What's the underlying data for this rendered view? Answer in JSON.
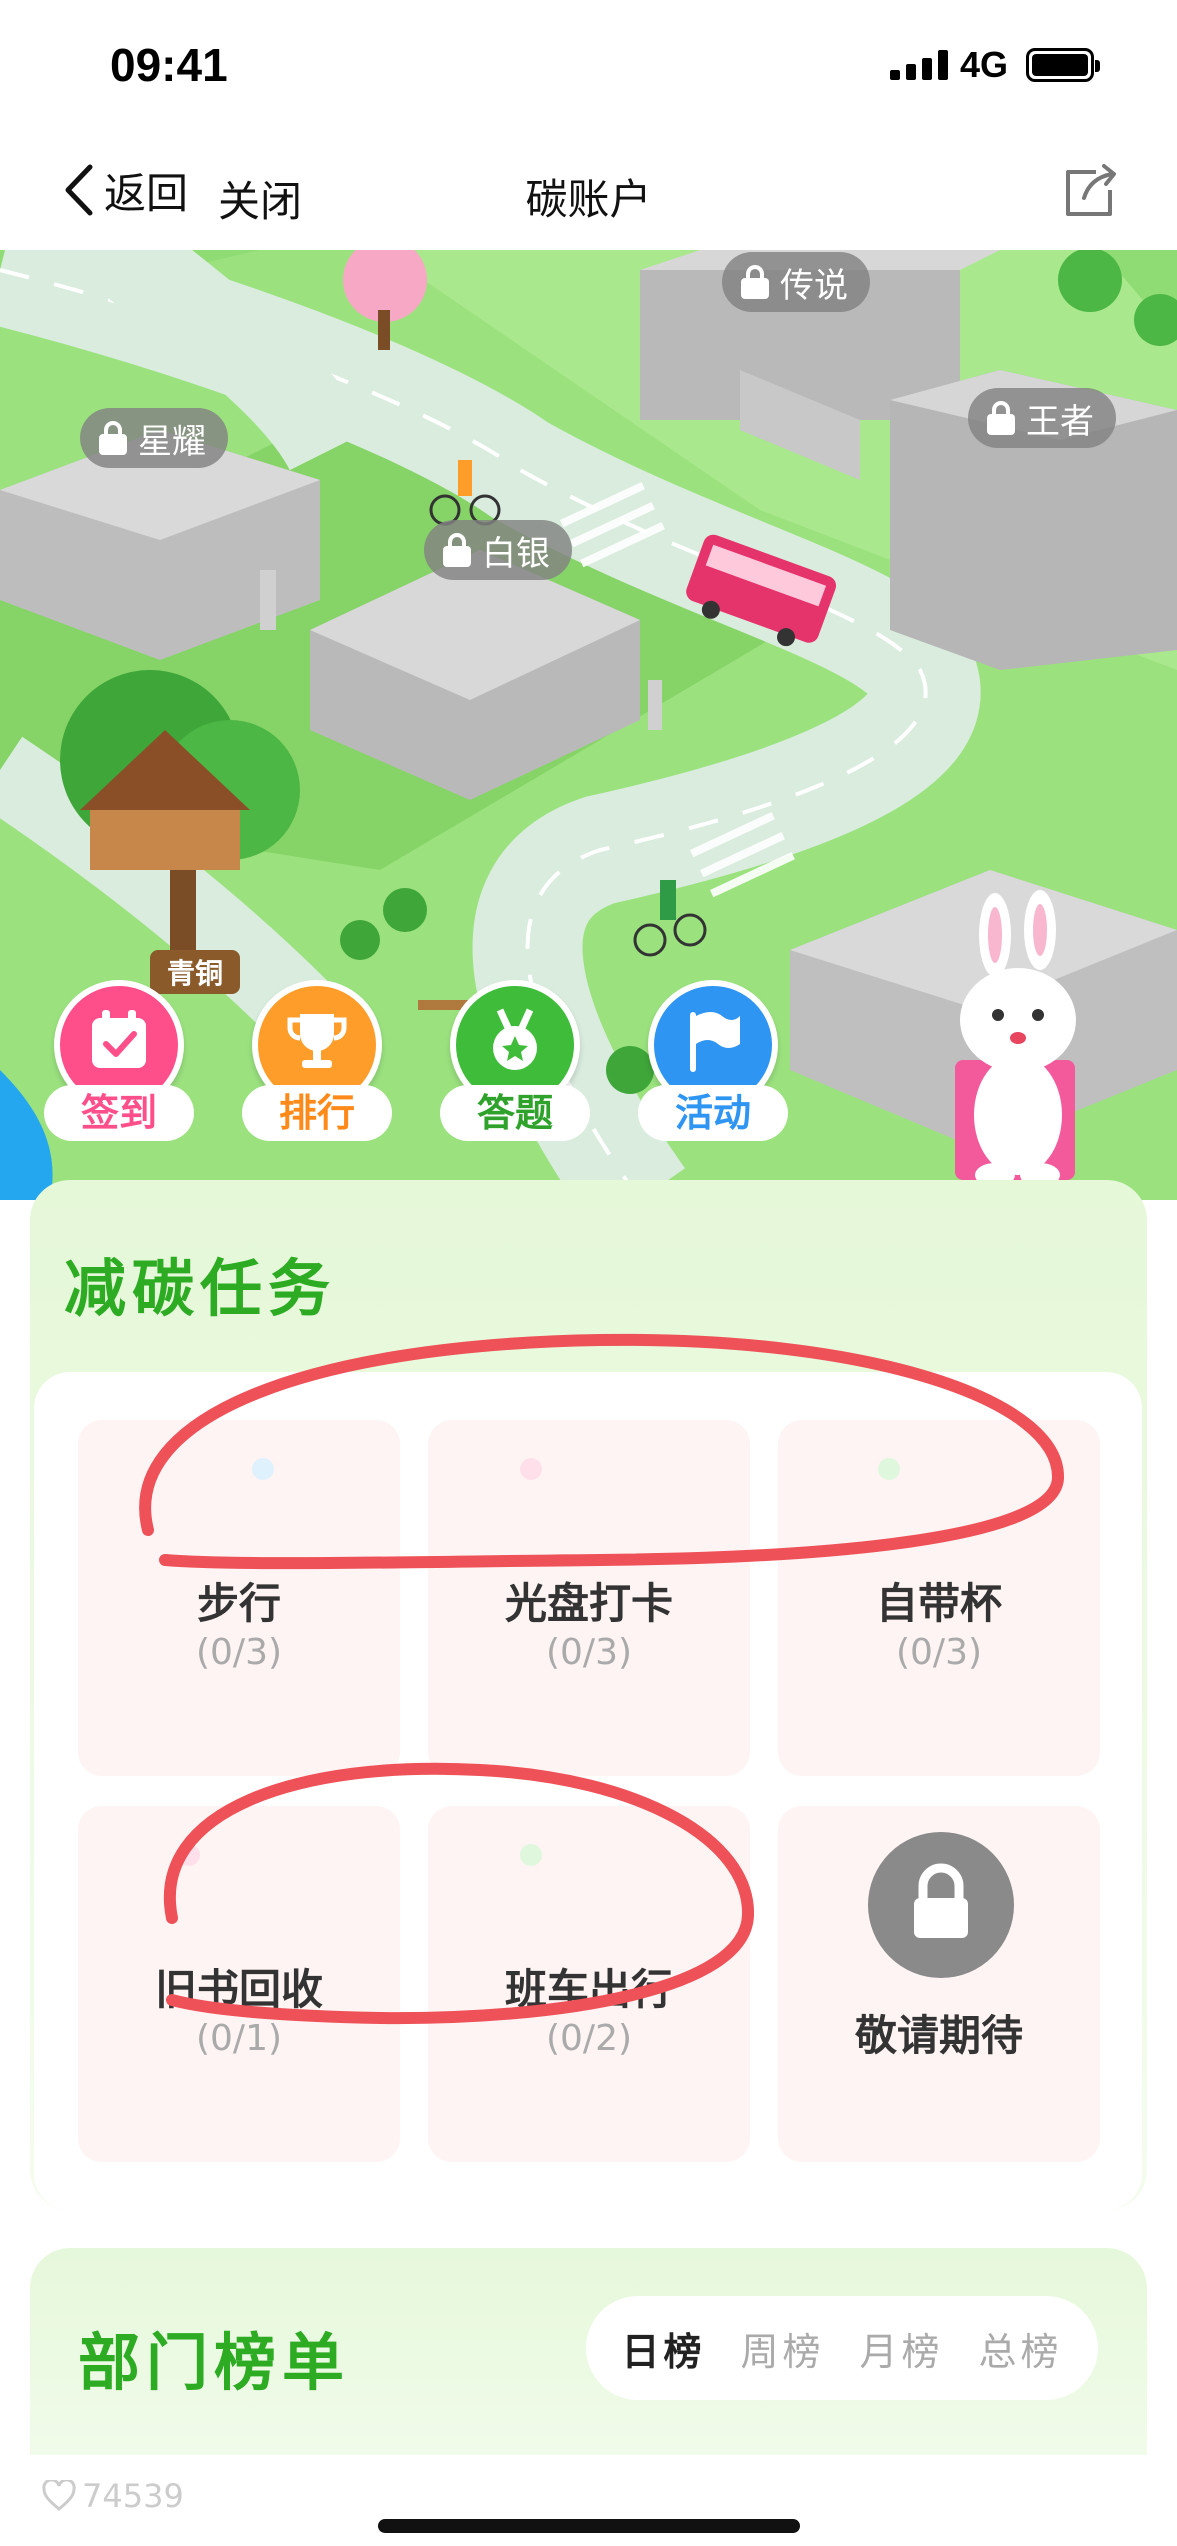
{
  "status_bar": {
    "time": "09:41",
    "network": "4G"
  },
  "nav": {
    "back_label": "返回",
    "close_label": "关闭",
    "title": "碳账户"
  },
  "map": {
    "locked_levels": [
      {
        "id": "legend",
        "label": "传说"
      },
      {
        "id": "starlight",
        "label": "星耀"
      },
      {
        "id": "king",
        "label": "王者"
      },
      {
        "id": "silver",
        "label": "白银"
      }
    ],
    "current_level": "青铜",
    "actions": [
      {
        "id": "checkin",
        "label": "签到",
        "color": "#ff4f8b"
      },
      {
        "id": "ranking",
        "label": "排行",
        "color": "#ff9d2b"
      },
      {
        "id": "quiz",
        "label": "答题",
        "color": "#3ebc3a"
      },
      {
        "id": "activity",
        "label": "活动",
        "color": "#2f95f2"
      }
    ]
  },
  "tasks": {
    "title": "减碳任务",
    "items": [
      {
        "id": "walking",
        "name": "步行",
        "progress": "(0/3)",
        "icon": "walking-icon",
        "color": "#7cc6f2"
      },
      {
        "id": "clean-plate",
        "name": "光盘打卡",
        "progress": "(0/3)",
        "icon": "plate-icon",
        "color": "#ff86a6"
      },
      {
        "id": "own-cup",
        "name": "自带杯",
        "progress": "(0/3)",
        "icon": "cup-icon",
        "color": "#55cc55"
      },
      {
        "id": "book-recycle",
        "name": "旧书回收",
        "progress": "(0/1)",
        "icon": "book-icon",
        "color": "#ff86a6"
      },
      {
        "id": "shuttle",
        "name": "班车出行",
        "progress": "(0/2)",
        "icon": "bus-icon",
        "color": "#55cc55"
      },
      {
        "id": "coming-soon",
        "name": "敬请期待",
        "progress": "",
        "icon": "lock-icon",
        "color": "#8a8a8a"
      }
    ]
  },
  "ranking": {
    "title": "部门榜单",
    "tabs": [
      "日榜",
      "周榜",
      "月榜",
      "总榜"
    ],
    "active_tab": "日榜"
  },
  "footer": {
    "likes": "74539"
  }
}
